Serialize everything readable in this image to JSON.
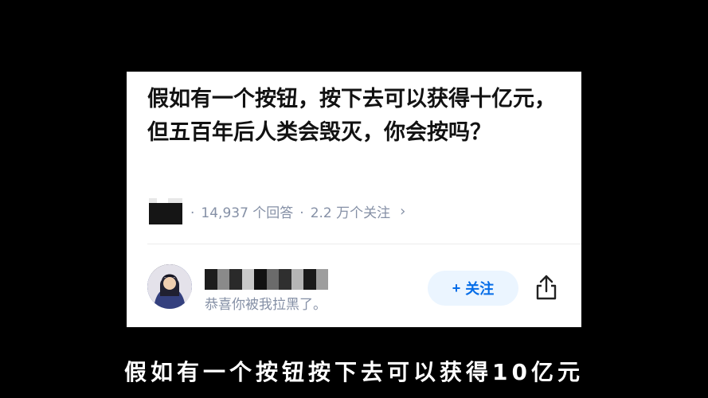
{
  "question": {
    "title": "假如有一个按钮，按下去可以获得十亿元，但五百年后人类会毁灭，你会按吗？"
  },
  "meta": {
    "answers": "14,937 个回答",
    "separator": "·",
    "followers": "2.2 万个关注",
    "chevron": "›"
  },
  "answer": {
    "bio": "恭喜你被我拉黑了。",
    "follow_plus": "+",
    "follow_label": "关注"
  },
  "caption": "假如有一个按钮按下去可以获得10亿元",
  "icons": {
    "share": "share-icon",
    "chevron": "chevron-right-icon"
  },
  "colors": {
    "background": "#000000",
    "card": "#ffffff",
    "accent": "#056de8",
    "follow_bg": "#ebf5ff",
    "meta_text": "#8590a6"
  }
}
